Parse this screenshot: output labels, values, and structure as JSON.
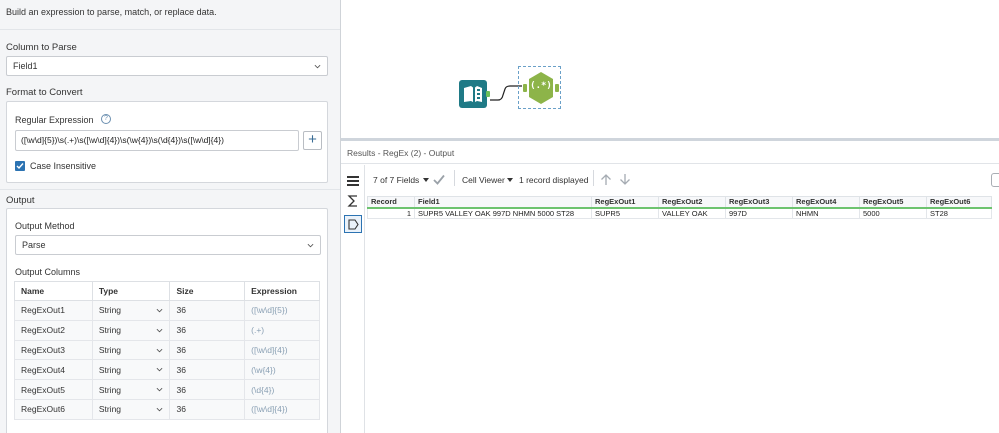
{
  "config": {
    "description": "Build an expression to parse, match, or replace data.",
    "column_to_parse": {
      "title": "Column to Parse",
      "value": "Field1"
    },
    "format_to_convert": {
      "title": "Format to Convert",
      "regex_label": "Regular Expression",
      "help_glyph": "?",
      "regex_value": "([\\w\\d]{5})\\s(.+)\\s([\\w\\d]{4})\\s(\\w{4})\\s(\\d{4})\\s([\\w\\d]{4})",
      "add_glyph": "+",
      "case_insensitive_label": "Case Insensitive",
      "case_insensitive": true
    },
    "output": {
      "title": "Output",
      "method_label": "Output Method",
      "method_value": "Parse",
      "columns_label": "Output Columns",
      "headers": [
        "Name",
        "Type",
        "Size",
        "Expression"
      ],
      "rows": [
        {
          "name": "RegExOut1",
          "type": "String",
          "size": "36",
          "expr": "([\\w\\d]{5})"
        },
        {
          "name": "RegExOut2",
          "type": "String",
          "size": "36",
          "expr": "(.+)"
        },
        {
          "name": "RegExOut3",
          "type": "String",
          "size": "36",
          "expr": "([\\w\\d]{4})"
        },
        {
          "name": "RegExOut4",
          "type": "String",
          "size": "36",
          "expr": "(\\w{4})"
        },
        {
          "name": "RegExOut5",
          "type": "String",
          "size": "36",
          "expr": "(\\d{4})"
        },
        {
          "name": "RegExOut6",
          "type": "String",
          "size": "36",
          "expr": "([\\w\\d]{4})"
        }
      ]
    }
  },
  "canvas": {
    "regex_tool_glyph": "(.*)"
  },
  "results": {
    "title": "Results - RegEx (2) - Output",
    "fields_label": "7 of 7 Fields",
    "viewer_label": "Cell Viewer",
    "records_label": "1 record displayed",
    "headers": [
      "Record",
      "Field1",
      "RegExOut1",
      "RegExOut2",
      "RegExOut3",
      "RegExOut4",
      "RegExOut5",
      "RegExOut6"
    ],
    "rows": [
      [
        "1",
        "SUPR5 VALLEY OAK 997D NHMN 5000 ST28",
        "SUPR5",
        "VALLEY OAK",
        "997D",
        "NHMN",
        "5000",
        "ST28"
      ]
    ]
  },
  "colors": {
    "accent_blue": "#2c73b2",
    "input_tool": "#1f7a86",
    "regex_tool": "#8db449",
    "connector": "#6dbf59"
  }
}
